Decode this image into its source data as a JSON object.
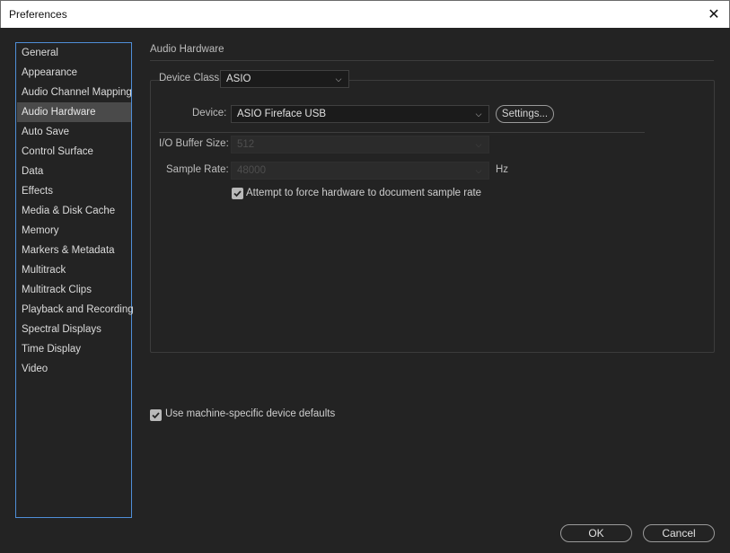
{
  "window": {
    "title": "Preferences",
    "close_glyph": "✕"
  },
  "sidebar": {
    "selected_index": 3,
    "items": [
      {
        "label": "General"
      },
      {
        "label": "Appearance"
      },
      {
        "label": "Audio Channel Mapping"
      },
      {
        "label": "Audio Hardware"
      },
      {
        "label": "Auto Save"
      },
      {
        "label": "Control Surface"
      },
      {
        "label": "Data"
      },
      {
        "label": "Effects"
      },
      {
        "label": "Media & Disk Cache"
      },
      {
        "label": "Memory"
      },
      {
        "label": "Markers & Metadata"
      },
      {
        "label": "Multitrack"
      },
      {
        "label": "Multitrack Clips"
      },
      {
        "label": "Playback and Recording"
      },
      {
        "label": "Spectral Displays"
      },
      {
        "label": "Time Display"
      },
      {
        "label": "Video"
      }
    ]
  },
  "panel": {
    "title": "Audio Hardware",
    "device_class": {
      "label": "Device Class:",
      "value": "ASIO"
    },
    "device": {
      "label": "Device:",
      "value": "ASIO Fireface USB",
      "settings_label": "Settings..."
    },
    "buffer_size": {
      "label": "I/O Buffer Size:",
      "value": "512"
    },
    "sample_rate": {
      "label": "Sample Rate:",
      "value": "48000",
      "unit": "Hz"
    },
    "force_rate": {
      "label": "Attempt to force hardware to document sample rate",
      "checked": true
    },
    "machine_defaults": {
      "label": "Use machine-specific device defaults",
      "checked": true
    }
  },
  "footer": {
    "ok_label": "OK",
    "cancel_label": "Cancel"
  },
  "colors": {
    "background": "#232323",
    "sidebar_border": "#4f8fd8",
    "selected_item": "#4a4a4a"
  }
}
